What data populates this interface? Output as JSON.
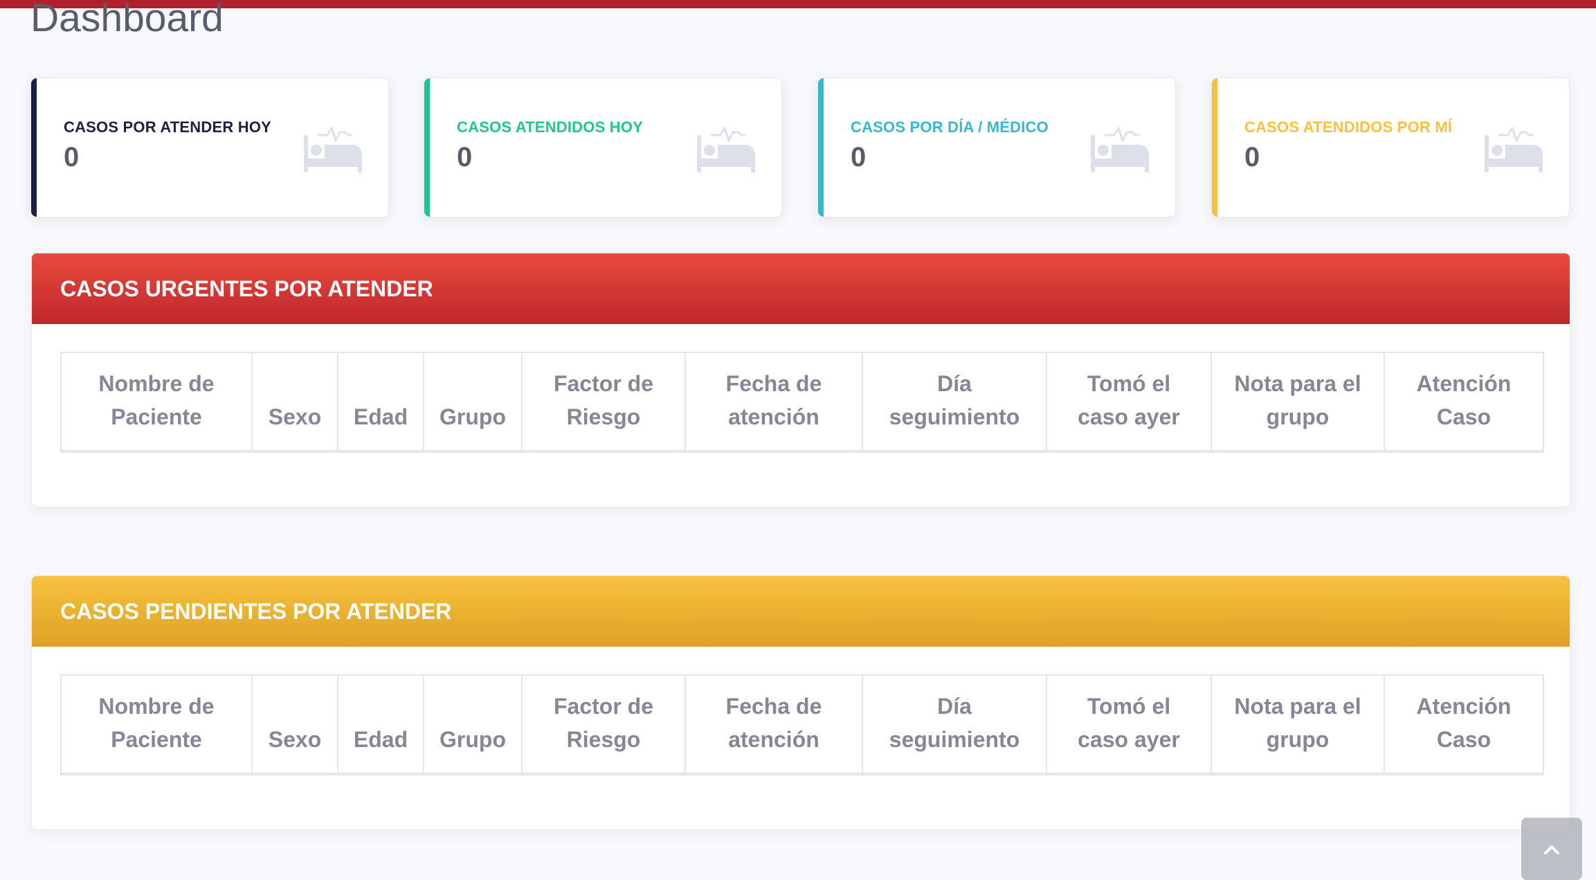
{
  "page": {
    "title": "Dashboard"
  },
  "kpis": [
    {
      "label": "CASOS POR ATENDER HOY",
      "value": "0",
      "accent": "#1c2042",
      "icon": "bed-icon"
    },
    {
      "label": "CASOS ATENDIDOS HOY",
      "value": "0",
      "accent": "#1cc88a",
      "icon": "bed-icon"
    },
    {
      "label": "CASOS POR DÍA / MÉDICO",
      "value": "0",
      "accent": "#36b9cc",
      "icon": "bed-icon"
    },
    {
      "label": "CASOS ATENDIDOS POR MÍ",
      "value": "0",
      "accent": "#f6c23e",
      "icon": "bed-icon"
    }
  ],
  "panels": {
    "urgent": {
      "title": "CASOS URGENTES POR ATENDER",
      "color_top": "#e74a3b",
      "color_bottom": "#c0272d"
    },
    "pending": {
      "title": "CASOS PENDIENTES POR ATENDER",
      "color_top": "#f6c23e",
      "color_bottom": "#dfa124"
    }
  },
  "table": {
    "headers": [
      {
        "line1": "Nombre de",
        "line2": "Paciente"
      },
      {
        "line1": "",
        "line2": "Sexo"
      },
      {
        "line1": "",
        "line2": "Edad"
      },
      {
        "line1": "",
        "line2": "Grupo"
      },
      {
        "line1": "Factor de",
        "line2": "Riesgo"
      },
      {
        "line1": "Fecha de",
        "line2": "atención"
      },
      {
        "line1": "Día",
        "line2": "seguimiento"
      },
      {
        "line1": "Tomó el",
        "line2": "caso ayer"
      },
      {
        "line1": "Nota para el",
        "line2": "grupo"
      },
      {
        "line1": "Atención",
        "line2": "Caso"
      }
    ]
  },
  "scroll_top": {
    "icon": "chevron-up-icon"
  }
}
